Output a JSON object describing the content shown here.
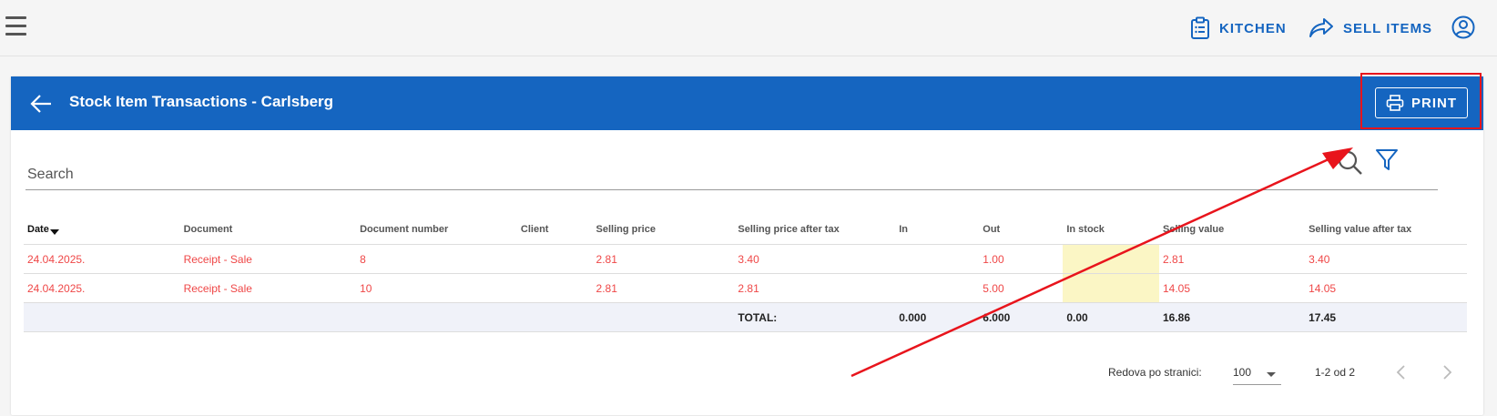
{
  "topbar": {
    "menu_icon": "hamburger-menu-icon",
    "kitchen_label": "KITCHEN",
    "sell_items_label": "SELL ITEMS",
    "account_icon": "account-circle-icon"
  },
  "header": {
    "title": "Stock Item Transactions - Carlsberg",
    "print_label": "PRINT",
    "back_icon": "arrow-left-icon",
    "print_icon": "printer-icon",
    "bg_color": "#1565c0"
  },
  "search": {
    "placeholder": "Search",
    "search_icon": "magnifier-icon",
    "filter_icon": "funnel-filter-icon"
  },
  "table": {
    "columns": [
      "Date",
      "Document",
      "Document number",
      "Client",
      "Selling price",
      "Selling price after tax",
      "In",
      "Out",
      "In stock",
      "Selling value",
      "Selling value after tax"
    ],
    "rows": [
      [
        "24.04.2025.",
        "Receipt - Sale",
        "8",
        "",
        "2.81",
        "3.40",
        "",
        "1.00",
        "",
        "2.81",
        "3.40"
      ],
      [
        "24.04.2025.",
        "Receipt - Sale",
        "10",
        "",
        "2.81",
        "2.81",
        "",
        "5.00",
        "",
        "14.05",
        "14.05"
      ]
    ],
    "total": {
      "label": "TOTAL:",
      "in": "0.000",
      "out": "6.000",
      "in_stock": "0.00",
      "selling_value": "16.86",
      "selling_value_after_tax": "17.45"
    },
    "row_text_color": "#ef4747",
    "stock_highlight_color": "#fbf6c5"
  },
  "pagination": {
    "rows_per_page_label": "Redova po stranici:",
    "rows_per_page_value": "100",
    "range_text": "1-2 od 2"
  },
  "annotation": {
    "highlight_color": "#e8141c"
  }
}
